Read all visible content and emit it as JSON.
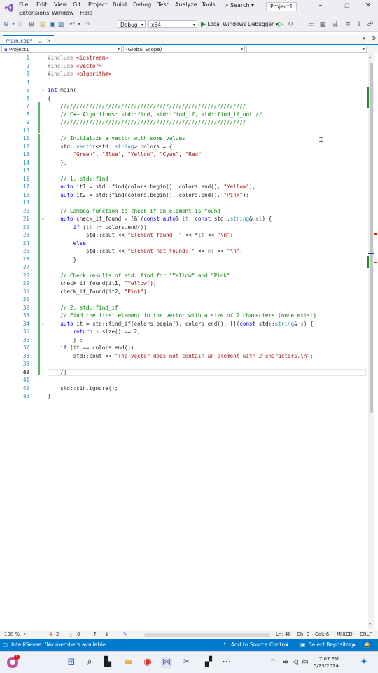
{
  "menubar": {
    "row1": [
      "File",
      "Edit",
      "View",
      "Git",
      "Project",
      "Build",
      "Debug",
      "Test",
      "Analyze",
      "Tools"
    ],
    "row2": [
      "Extensions",
      "Window",
      "Help"
    ],
    "search_label": "Search",
    "project_name": "Project1"
  },
  "toolbar": {
    "config": "Debug",
    "platform": "x64",
    "run_label": "Local Windows Debugger"
  },
  "tab": {
    "label": "main.cpp*"
  },
  "navbar": {
    "project": "Project1",
    "scope": "(Global Scope)"
  },
  "code": {
    "current_line": 40,
    "lines": [
      {
        "n": 1,
        "html": "<span class='pp'>#include</span> <span class='str'>&lt;iostream&gt;</span>"
      },
      {
        "n": 2,
        "html": "<span class='pp'>#include</span> <span class='str'>&lt;vector&gt;</span>"
      },
      {
        "n": 3,
        "html": "<span class='pp'>#include</span> <span class='str'>&lt;algorithm&gt;</span>"
      },
      {
        "n": 4,
        "html": ""
      },
      {
        "n": 5,
        "html": "<span class='kw'>int</span> main()"
      },
      {
        "n": 6,
        "html": "{"
      },
      {
        "n": 7,
        "html": "    <span class='cmt'>//////////////////////////////////////////////////////////</span>"
      },
      {
        "n": 8,
        "html": "    <span class='cmt'>// C++ Algorithms: std::find, std::find_if, std::find_if_not //</span>"
      },
      {
        "n": 9,
        "html": "    <span class='cmt'>//////////////////////////////////////////////////////////</span>"
      },
      {
        "n": 10,
        "html": ""
      },
      {
        "n": 11,
        "html": "    <span class='cmt'>// Initialize a vector with some values</span>"
      },
      {
        "n": 12,
        "html": "    std::<span class='ty'>vector</span>&lt;std::<span class='ty'>string</span>&gt; colors = {"
      },
      {
        "n": 13,
        "html": "        <span class='str'>\"Green\"</span>, <span class='str'>\"Blue\"</span>, <span class='str'>\"Yellow\"</span>, <span class='str'>\"Cyan\"</span>, <span class='str'>\"Red\"</span>"
      },
      {
        "n": 14,
        "html": "    };"
      },
      {
        "n": 15,
        "html": ""
      },
      {
        "n": 16,
        "html": "    <span class='cmt'>// 1. std::find</span>"
      },
      {
        "n": 17,
        "html": "    <span class='kw'>auto</span> it1 = std::find(colors.begin(), colors.end(), <span class='str'>\"Yellow\"</span>);"
      },
      {
        "n": 18,
        "html": "    <span class='kw'>auto</span> it2 = std::find(colors.begin(), colors.end(), <span class='str'>\"Pink\"</span>);"
      },
      {
        "n": 19,
        "html": ""
      },
      {
        "n": 20,
        "html": "    <span class='cmt'>// Lambda function to check if an element is found</span>"
      },
      {
        "n": 21,
        "html": "    <span class='kw'>auto</span> check_if_found = [&amp;](<span class='kw'>const</span> <span class='kw'>auto</span>&amp; <span class='par'>it</span>, <span class='kw'>const</span> std::<span class='ty'>string</span>&amp; <span class='par'>el</span>) {"
      },
      {
        "n": 22,
        "html": "        <span class='kw'>if</span> (<span class='par'>it</span> != colors.end())"
      },
      {
        "n": 23,
        "html": "            std::cout &lt;&lt; <span class='str'>\"Element found: \"</span> &lt;&lt; *<span class='par'>it</span> &lt;&lt; <span class='str'>\"\\n\"</span>;"
      },
      {
        "n": 24,
        "html": "        <span class='kw'>else</span>"
      },
      {
        "n": 25,
        "html": "            std::cout &lt;&lt; <span class='str'>\"Element not found: \"</span> &lt;&lt; <span class='par'>el</span> &lt;&lt; <span class='str'>\"\\n\"</span>;"
      },
      {
        "n": 26,
        "html": "        };"
      },
      {
        "n": 27,
        "html": ""
      },
      {
        "n": 28,
        "html": "    <span class='cmt'>// Check results of std::find for \"Yellow\" and \"Pink\"</span>"
      },
      {
        "n": 29,
        "html": "    check_if_found(it1, <span class='str'>\"Yellow\"</span>);"
      },
      {
        "n": 30,
        "html": "    check_if_found(it2, <span class='str'>\"Pink\"</span>);"
      },
      {
        "n": 31,
        "html": ""
      },
      {
        "n": 32,
        "html": "    <span class='cmt'>// 2. std::find_if</span>"
      },
      {
        "n": 33,
        "html": "    <span class='cmt'>// Find the first element in the vector with a size of 2 characters (none exist)</span>"
      },
      {
        "n": 34,
        "html": "    <span class='kw'>auto</span> it = std::find_if(colors.begin(), colors.end(), [](<span class='kw'>const</span> std::<span class='ty'>string</span>&amp; <span class='par'>s</span>) {"
      },
      {
        "n": 35,
        "html": "        <span class='kw'>return</span> <span class='par'>s</span>.size() == 2;"
      },
      {
        "n": 36,
        "html": "        });"
      },
      {
        "n": 37,
        "html": "    <span class='kw'>if</span> (it == colors.end())"
      },
      {
        "n": 38,
        "html": "        std::cout &lt;&lt; <span class='str'>\"The vector does not contain an element with 2 characters.\\n\"</span>;"
      },
      {
        "n": 39,
        "html": ""
      },
      {
        "n": 40,
        "html": "    /|"
      },
      {
        "n": 41,
        "html": ""
      },
      {
        "n": 42,
        "html": "    std::cin.ignore();"
      },
      {
        "n": 43,
        "html": "}"
      }
    ]
  },
  "editor_status": {
    "zoom": "108 %",
    "errors": "2",
    "warnings": "0",
    "ln": "Ln: 40",
    "ch": "Ch: 3",
    "col": "Col: 6",
    "tabs": "MIXED",
    "eol": "CRLF"
  },
  "statusbar": {
    "message": "IntelliSense: 'No members available'",
    "add_source": "Add to Source Control",
    "select_repo": "Select Repository"
  },
  "taskbar": {
    "time": "7:07 PM",
    "date": "5/23/2024",
    "badge": "1"
  },
  "colors": {
    "accent": "#007acc",
    "keyword": "#0000ff",
    "string": "#a31515",
    "comment": "#008000",
    "type": "#2b91af"
  }
}
